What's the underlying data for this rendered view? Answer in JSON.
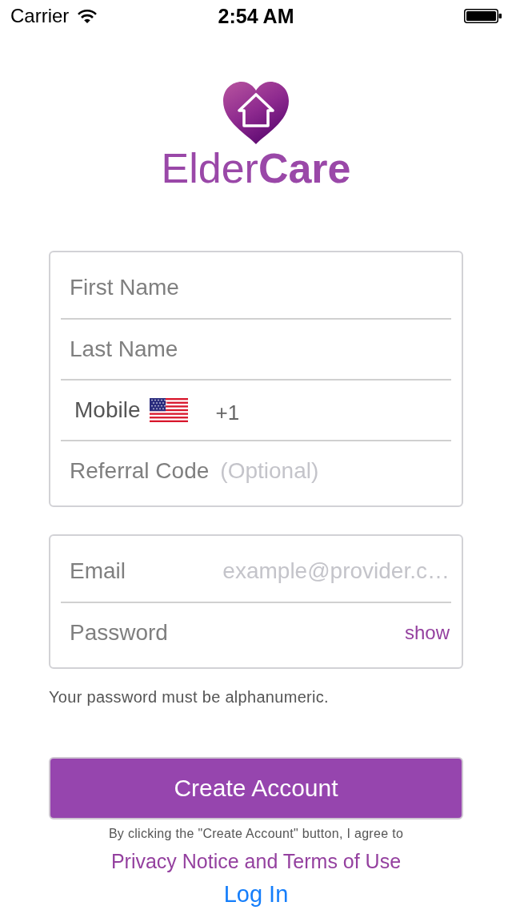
{
  "status_bar": {
    "carrier": "Carrier",
    "time": "2:54 AM"
  },
  "logo": {
    "wordmark": "Elder**Care**"
  },
  "profile_fields": [
    {
      "kind": "name",
      "placeholder": "First Name"
    },
    {
      "kind": "name",
      "placeholder": "Last Name"
    },
    {
      "kind": "phone",
      "label": "Mobile",
      "country_code": "+1"
    },
    {
      "kind": "labeled",
      "label": "Referral Code",
      "placeholder": "(Optional)"
    }
  ],
  "account_fields": [
    {
      "kind": "email",
      "label": "Email",
      "placeholder": "example@provider.c…"
    },
    {
      "kind": "password",
      "placeholder": "Password",
      "toggle": "show"
    }
  ],
  "hint": "Your password must be alphanumeric.",
  "create_button": "Create Account",
  "terms": {
    "text": "By clicking the \"Create Account\" button, I agree to",
    "link": "Privacy Notice and Terms of Use"
  },
  "login_link": "Log In"
}
